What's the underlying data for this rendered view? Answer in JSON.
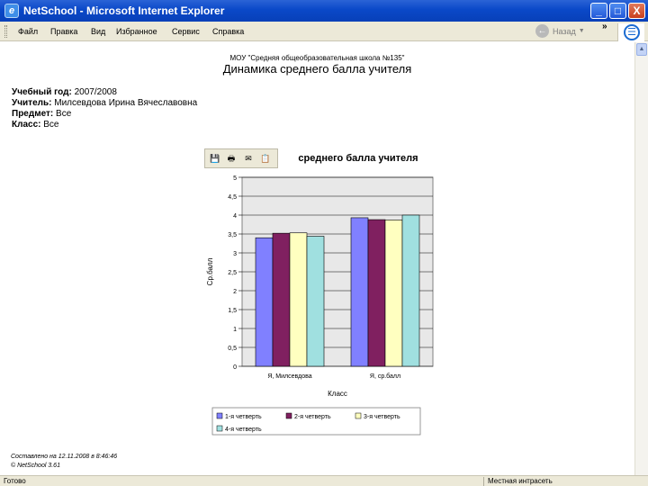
{
  "window": {
    "title": "NetSchool - Microsoft Internet Explorer",
    "app_icon": "ie-page-icon",
    "controls": {
      "minimize": "_",
      "maximize": "□",
      "close": "X"
    }
  },
  "menubar": {
    "items": [
      "Файл",
      "Правка",
      "Вид",
      "Избранное",
      "Сервис",
      "Справка"
    ],
    "back_label": "Назад",
    "chevron": "»",
    "logo": "windows-flag-icon"
  },
  "report": {
    "school": "МОУ \"Средняя общеобразовательная школа №135\"",
    "title": "Динамика среднего балла учителя",
    "fields": [
      {
        "label": "Учебный год:",
        "value": " 2007/2008"
      },
      {
        "label": "Учитель:",
        "value": " Милсевдова Ирина Вячеславовна"
      },
      {
        "label": "Предмет:",
        "value": " Все"
      },
      {
        "label": "Класс:",
        "value": " Все"
      }
    ],
    "created": "Составлено на 12.11.2008 в 8:46:46",
    "copyright": "© NetSchool 3.61"
  },
  "chart_toolbar": {
    "icons": [
      "save-icon",
      "print-icon",
      "email-icon",
      "copy-icon"
    ]
  },
  "chart_data": {
    "type": "bar",
    "title": "Динамика среднего балла учителя",
    "title_visible": "среднего балла учителя",
    "xlabel": "Класс",
    "ylabel": "Ср.балл",
    "ylim": [
      0,
      5
    ],
    "yticks": [
      "0",
      "0,5",
      "1",
      "1,5",
      "2",
      "2,5",
      "3",
      "3,5",
      "4",
      "4,5",
      "5"
    ],
    "categories": [
      "Я, Милсевдова",
      "Я, ср.балл"
    ],
    "series": [
      {
        "name": "1-я четверть",
        "color": "#8080ff",
        "values": [
          3.4,
          3.93
        ]
      },
      {
        "name": "2-я четверть",
        "color": "#802060",
        "values": [
          3.52,
          3.88
        ]
      },
      {
        "name": "3-я четверть",
        "color": "#ffffc0",
        "values": [
          3.53,
          3.87
        ]
      },
      {
        "name": "4-я четверть",
        "color": "#a0e0e0",
        "values": [
          3.44,
          4.0
        ]
      }
    ],
    "grid": true,
    "legend": "bottom",
    "plot_bg": "#e8e8e8"
  },
  "statusbar": {
    "left": "Готово",
    "zone": "Местная интрасеть"
  }
}
